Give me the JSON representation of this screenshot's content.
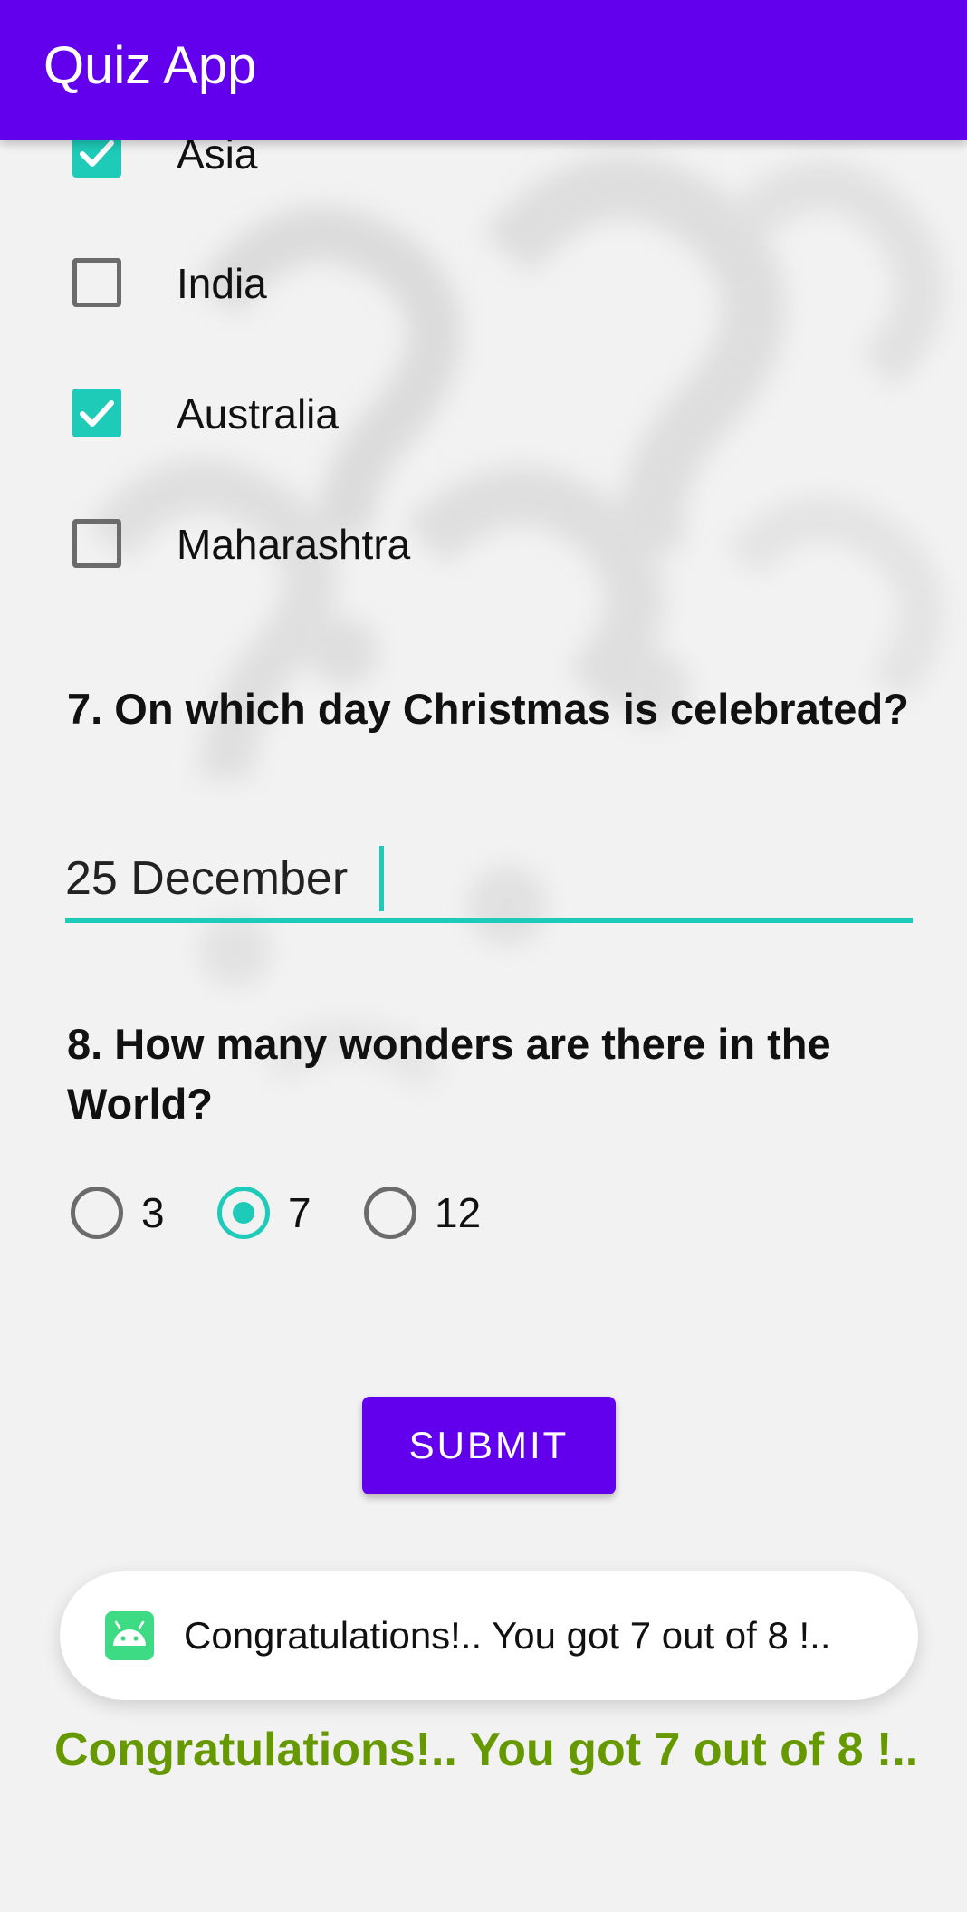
{
  "app": {
    "title": "Quiz App"
  },
  "colors": {
    "primary": "#6200EE",
    "accent": "#1ECBB8",
    "result_text": "#669900",
    "toast_icon": "#3DDC84"
  },
  "question6": {
    "options": [
      {
        "label": "Asia",
        "checked": true
      },
      {
        "label": "India",
        "checked": false
      },
      {
        "label": "Australia",
        "checked": true
      },
      {
        "label": "Maharashtra",
        "checked": false
      }
    ]
  },
  "question7": {
    "text": "7. On which day Christmas is celebrated?",
    "answer": "25 December"
  },
  "question8": {
    "text": "8. How many wonders are there in the World?",
    "options": [
      {
        "label": "3",
        "selected": false
      },
      {
        "label": "7",
        "selected": true
      },
      {
        "label": "12",
        "selected": false
      }
    ]
  },
  "submit": {
    "label": "SUBMIT"
  },
  "toast": {
    "icon": "android-icon",
    "message": "Congratulations!.. You got 7 out of 8 !.."
  },
  "result": {
    "message": "Congratulations!.. You got 7 out of 8 !.."
  }
}
